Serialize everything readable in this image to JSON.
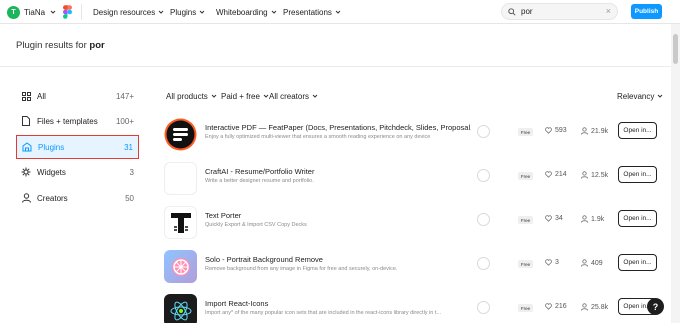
{
  "topbar": {
    "user_initial": "T",
    "user_name": "TiaNa",
    "nav": [
      "Design resources",
      "Plugins",
      "Whiteboarding",
      "Presentations"
    ],
    "search_value": "por",
    "search_placeholder": "Search",
    "publish_label": "Publish"
  },
  "heading": {
    "prefix": "Plugin results for ",
    "query": "por"
  },
  "sidebar": {
    "items": [
      {
        "label": "All",
        "count": "147+",
        "icon": "grid-icon"
      },
      {
        "label": "Files + templates",
        "count": "100+",
        "icon": "file-icon"
      },
      {
        "label": "Plugins",
        "count": "31",
        "icon": "plugin-icon"
      },
      {
        "label": "Widgets",
        "count": "3",
        "icon": "widget-icon"
      },
      {
        "label": "Creators",
        "count": "50",
        "icon": "person-icon"
      }
    ]
  },
  "filters": {
    "products": "All products",
    "price": "Paid + free",
    "creators": "All creators",
    "sort": "Relevancy"
  },
  "results": [
    {
      "title": "Interactive PDF — FeatPaper (Docs, Presentations, Pitchdeck, Slides, Proposal, Port...",
      "desc": "Enjoy a fully optimized multi-viewer that ensures a smooth reading experience on any device",
      "badge": "Free",
      "likes": "593",
      "users": "21.9k",
      "open": "Open in...",
      "icon": "featpaper-logo-icon"
    },
    {
      "title": "CraftAI - Resume/Portfolio Writer",
      "desc": "Write a better designer resume and portfolio.",
      "badge": "Free",
      "likes": "214",
      "users": "12.5k",
      "open": "Open in...",
      "icon": "craftai-logo-icon"
    },
    {
      "title": "Text Porter",
      "desc": "Quickly Export & Import CSV Copy Decks",
      "badge": "Free",
      "likes": "34",
      "users": "1.9k",
      "open": "Open in...",
      "icon": "text-porter-logo-icon"
    },
    {
      "title": "Solo - Portrait Background Remove",
      "desc": "Remove background from any image in Figma for free and securely, on-device.",
      "badge": "Free",
      "likes": "3",
      "users": "409",
      "open": "Open in...",
      "icon": "solo-logo-icon"
    },
    {
      "title": "Import React-Icons",
      "desc": "Import any* of the many popular icon sets that are included in the react-icons library directly in t...",
      "badge": "Free",
      "likes": "216",
      "users": "25.8k",
      "open": "Open in...",
      "icon": "react-icons-logo-icon"
    }
  ],
  "help_label": "?",
  "colors": {
    "accent": "#0d99ff",
    "avatar": "#1bb55c",
    "highlight_border": "#e53935"
  }
}
